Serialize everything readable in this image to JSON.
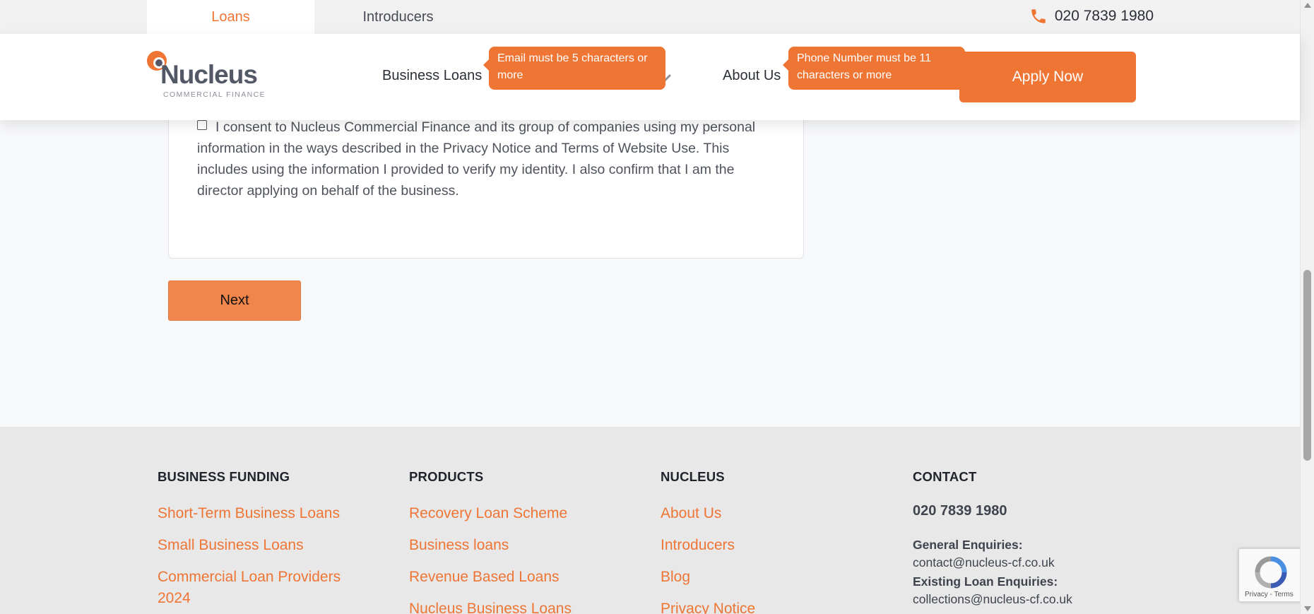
{
  "topbar": {
    "tabs": [
      {
        "label": "Loans",
        "active": true
      },
      {
        "label": "Introducers",
        "active": false
      }
    ],
    "phone": "020 7839 1980",
    "phone_icon": "phone-icon"
  },
  "header": {
    "logo_word": "Nucleus",
    "logo_sub": "COMMERCIAL FINANCE",
    "nav": {
      "business_loans": "Business Loans",
      "about_us": "About Us"
    },
    "apply_label": "Apply Now",
    "tooltips": {
      "email": "Email must be 5 characters or more",
      "phone": "Phone Number must be 11 characters or more"
    }
  },
  "form": {
    "consent_text": "I consent to Nucleus Commercial Finance and its group of companies using my personal information in the ways described in the Privacy Notice and Terms of Website Use. This includes using the information I provided to verify my identity. I also confirm that I am the director applying on behalf of the business.",
    "consent_checked": false,
    "next_label": "Next"
  },
  "footer": {
    "business_funding": {
      "heading": "BUSINESS FUNDING",
      "links": [
        "Short-Term Business Loans",
        "Small Business Loans",
        "Commercial Loan Providers 2024"
      ]
    },
    "products": {
      "heading": "PRODUCTS",
      "links": [
        "Recovery Loan Scheme",
        "Business loans",
        "Revenue Based Loans",
        "Nucleus Business Loans"
      ]
    },
    "nucleus": {
      "heading": "NUCLEUS",
      "links": [
        "About Us",
        "Introducers",
        "Blog",
        "Privacy Notice"
      ]
    },
    "contact": {
      "heading": "CONTACT",
      "phone": "020 7839 1980",
      "general_label": "General Enquiries:",
      "general_email": "contact@nucleus-cf.co.uk",
      "existing_label": "Existing Loan Enquiries:",
      "existing_email": "collections@nucleus-cf.co.uk"
    }
  },
  "recaptcha": {
    "text": "Privacy - Terms"
  },
  "colors": {
    "accent": "#ef7535",
    "footer_bg": "#e8e8e8",
    "page_bg": "#f7f8fa"
  }
}
